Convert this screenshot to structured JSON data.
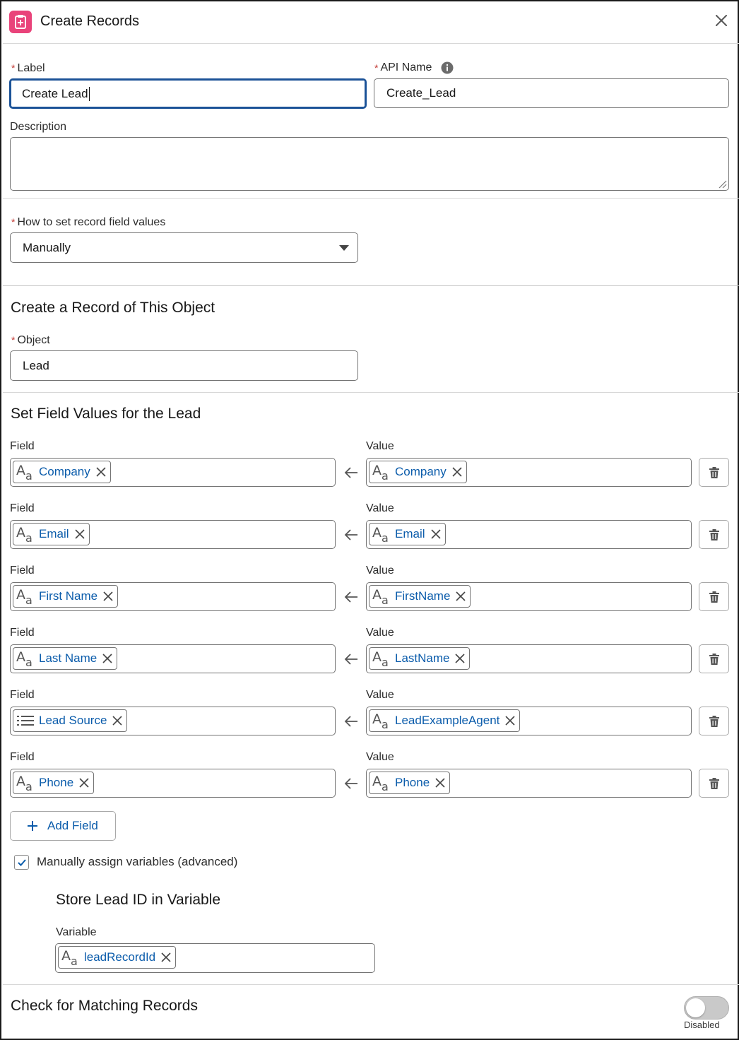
{
  "header": {
    "title": "Create Records"
  },
  "label_field": {
    "label": "Label",
    "value": "Create Lead"
  },
  "api_name_field": {
    "label": "API Name",
    "value": "Create_Lead"
  },
  "description_field": {
    "label": "Description",
    "value": ""
  },
  "how_to_set": {
    "label": "How to set record field values",
    "value": "Manually"
  },
  "object_section": {
    "title": "Create a Record of This Object",
    "object_label": "Object",
    "object_value": "Lead"
  },
  "field_values": {
    "title": "Set Field Values for the Lead",
    "field_label": "Field",
    "value_label": "Value",
    "rows": [
      {
        "field": "Company",
        "field_icon": "text-type-icon",
        "value": "Company",
        "value_icon": "text-type-icon"
      },
      {
        "field": "Email",
        "field_icon": "text-type-icon",
        "value": "Email",
        "value_icon": "text-type-icon"
      },
      {
        "field": "First Name",
        "field_icon": "text-type-icon",
        "value": "FirstName",
        "value_icon": "text-type-icon"
      },
      {
        "field": "Last Name",
        "field_icon": "text-type-icon",
        "value": "LastName",
        "value_icon": "text-type-icon"
      },
      {
        "field": "Lead Source",
        "field_icon": "picklist-icon",
        "value": "LeadExampleAgent",
        "value_icon": "text-type-icon"
      },
      {
        "field": "Phone",
        "field_icon": "text-type-icon",
        "value": "Phone",
        "value_icon": "text-type-icon"
      }
    ],
    "add_button": "Add Field"
  },
  "manual_assign": {
    "label": "Manually assign variables (advanced)",
    "checked": true
  },
  "store_id": {
    "title": "Store Lead ID in Variable",
    "variable_label": "Variable",
    "variable_value": "leadRecordId"
  },
  "matching": {
    "title": "Check for Matching Records",
    "toggle_label": "Disabled",
    "enabled": false
  },
  "colors": {
    "accent": "#0b5cab",
    "header_icon": "#e9437a",
    "focus_border": "#1b5297",
    "required": "#c23934"
  }
}
